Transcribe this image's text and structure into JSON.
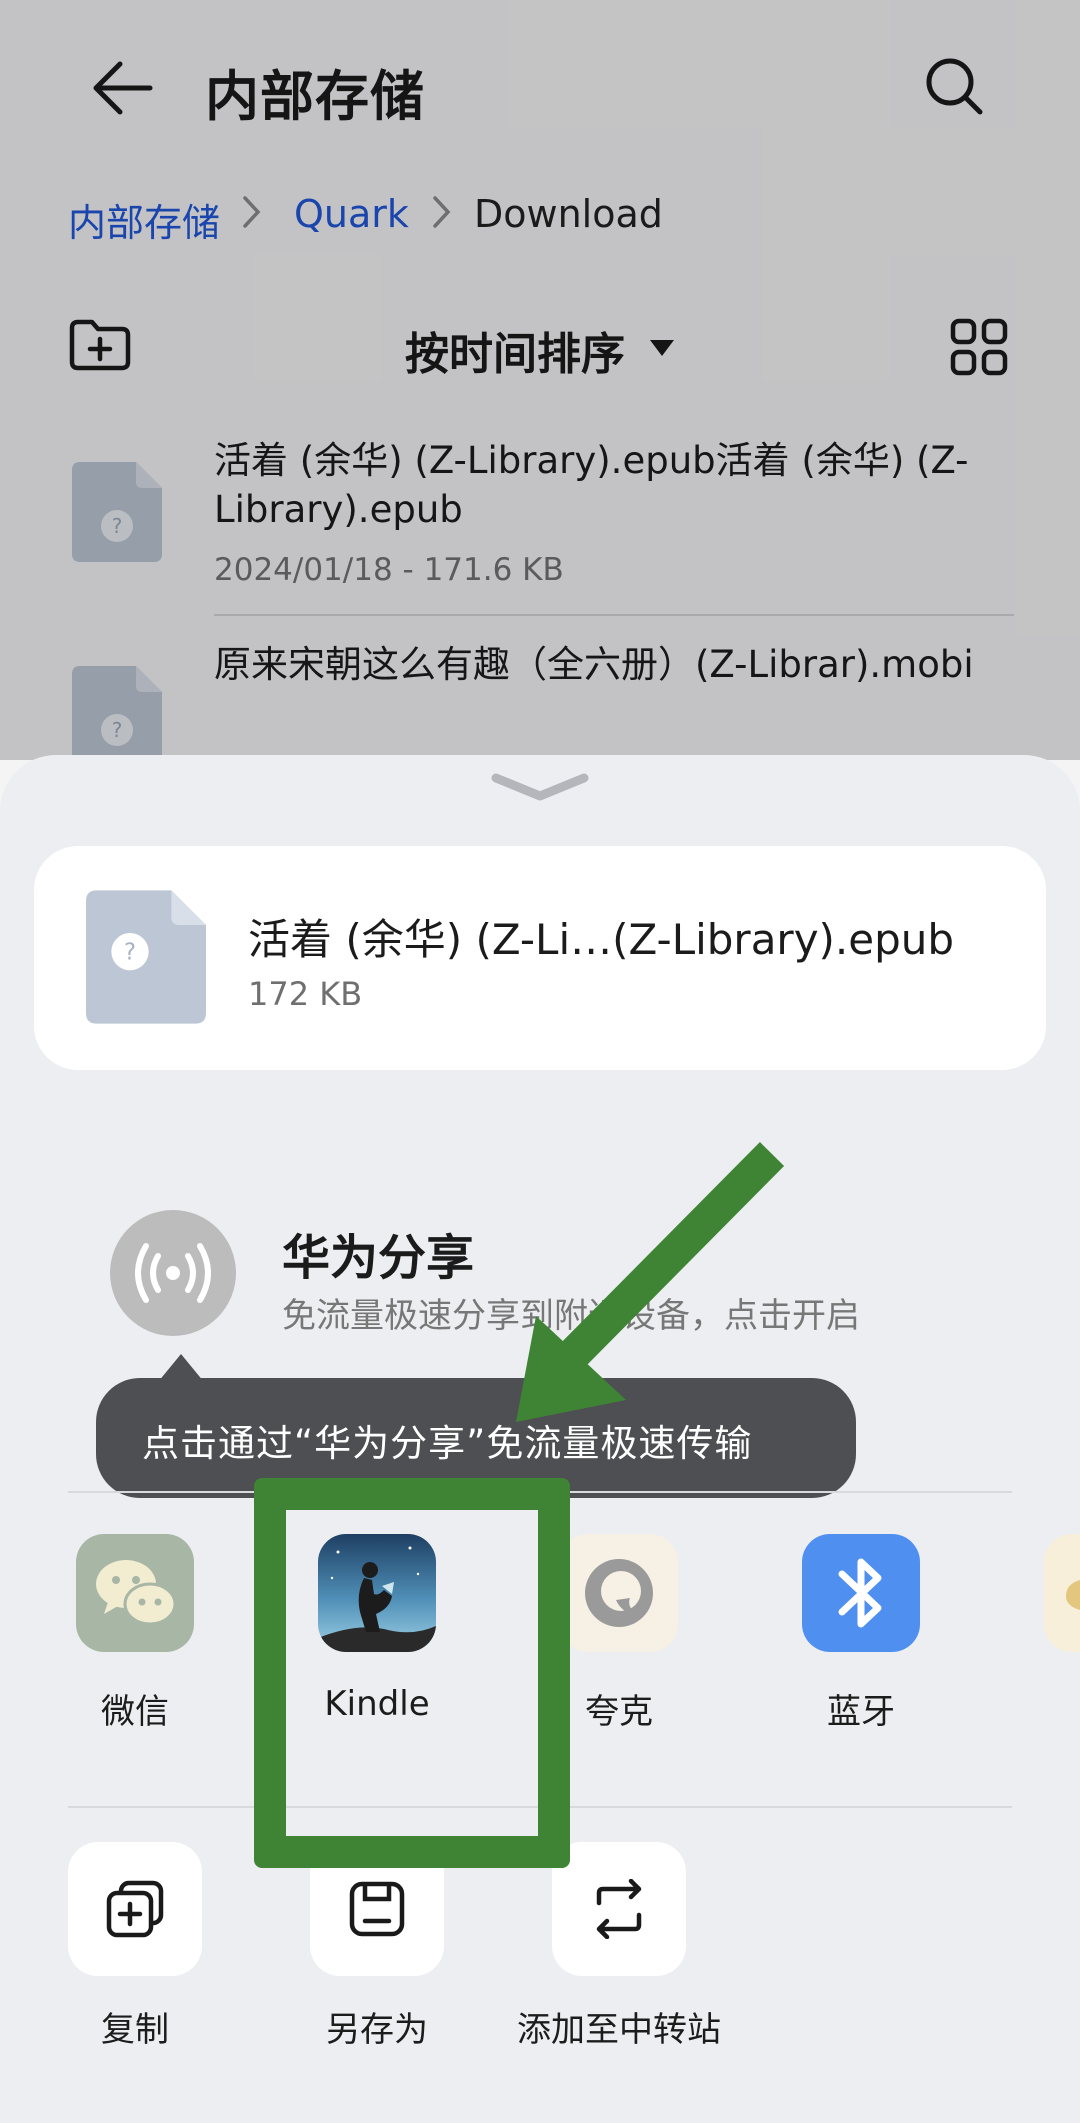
{
  "header": {
    "title": "内部存储"
  },
  "breadcrumb": [
    "内部存储",
    "Quark",
    "Download"
  ],
  "toolbar": {
    "sort_label": "按时间排序"
  },
  "files": [
    {
      "name": "活着 (余华) (Z-Library).epub活着 (余华) (Z-Library).epub",
      "meta": "2024/01/18 - 171.6 KB"
    },
    {
      "name": "原来宋朝这么有趣（全六册）(Z-Librar).mobi",
      "meta": ""
    }
  ],
  "share_sheet": {
    "file": {
      "name": "活着 (余华) (Z-Li…(Z-Library).epub",
      "size": "172 KB"
    },
    "huawei_share": {
      "title": "华为分享",
      "subtitle": "免流量极速分享到附近设备，点击开启"
    },
    "tooltip": "点击通过“华为分享”免流量极速传输",
    "apps": [
      {
        "label": "微信",
        "icon": "wechat-icon"
      },
      {
        "label": "Kindle",
        "icon": "kindle-icon"
      },
      {
        "label": "夸克",
        "icon": "quark-icon"
      },
      {
        "label": "蓝牙",
        "icon": "bluetooth-icon"
      }
    ],
    "actions": [
      {
        "label": "复制",
        "icon": "copy-icon"
      },
      {
        "label": "另存为",
        "icon": "save-as-icon"
      },
      {
        "label": "添加至中转站",
        "icon": "transfer-station-icon"
      }
    ]
  },
  "colors": {
    "link": "#1f56d6",
    "annotation_green": "#3f8434",
    "bluetooth": "#4f8ff0"
  }
}
